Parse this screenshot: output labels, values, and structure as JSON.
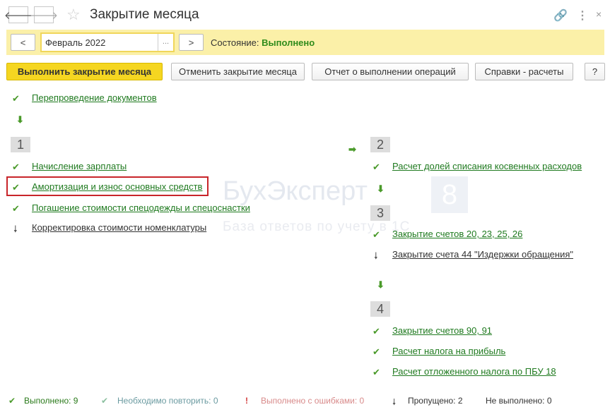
{
  "window": {
    "title": "Закрытие месяца"
  },
  "period": {
    "prev": "<",
    "value": "Февраль 2022",
    "select": "...",
    "next": ">",
    "state_label": "Состояние:",
    "state_value": "Выполнено"
  },
  "toolbar": {
    "run": "Выполнить закрытие месяца",
    "cancel": "Отменить закрытие месяца",
    "report": "Отчет о выполнении операций",
    "refs": "Справки - расчеты",
    "help": "?"
  },
  "pre": {
    "label": "Перепроведение документов"
  },
  "stage1": {
    "num": "1",
    "items": [
      "Начисление зарплаты",
      "Амортизация и износ основных средств",
      "Погашение стоимости спецодежды и спецоснастки",
      "Корректировка стоимости номенклатуры"
    ]
  },
  "stage2": {
    "num": "2",
    "items": [
      "Расчет долей списания косвенных расходов"
    ]
  },
  "stage3": {
    "num": "3",
    "items": [
      "Закрытие счетов 20, 23, 25, 26",
      "Закрытие счета 44 \"Издержки обращения\""
    ]
  },
  "stage4": {
    "num": "4",
    "items": [
      "Закрытие счетов 90, 91",
      "Расчет налога на прибыль",
      "Расчет отложенного налога по ПБУ 18"
    ]
  },
  "watermark": {
    "brand": "БухЭксперт",
    "digit": "8",
    "tagline": "База ответов по учету в 1С"
  },
  "footer": {
    "done": "Выполнено: 9",
    "repeat": "Необходимо повторить: 0",
    "errors": "Выполнено с ошибками: 0",
    "skipped": "Пропущено: 2",
    "notdone": "Не выполнено: 0"
  },
  "colors": {
    "accent": "#f5d621",
    "ok": "#4a9a2a",
    "error": "#c8252a"
  }
}
